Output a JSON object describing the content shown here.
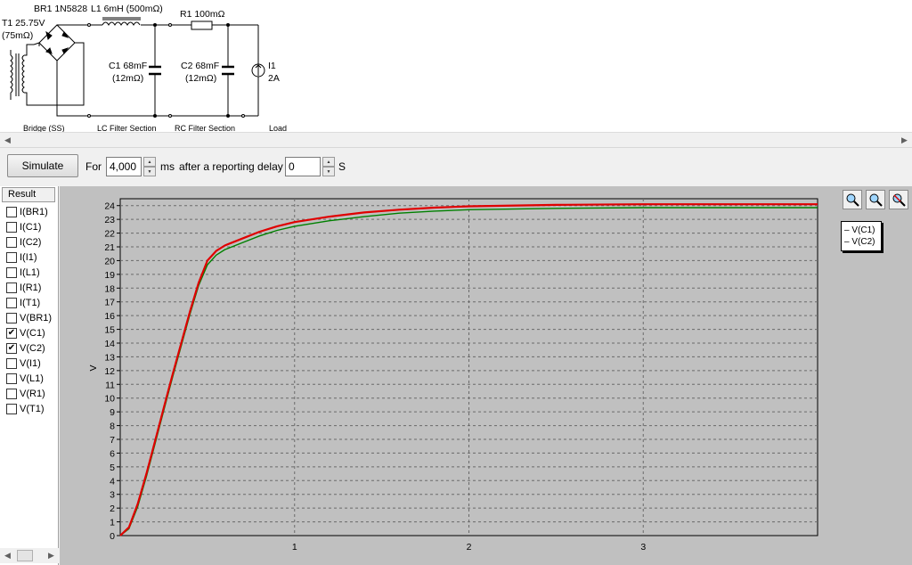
{
  "schematic": {
    "transformer_label": "T1 25.75V",
    "transformer_resistance": "(75mΩ)",
    "bridge_label": "BR1 1N5828",
    "inductor_label": "L1 6mH (500mΩ)",
    "resistor_label": "R1 100mΩ",
    "c1_label": "C1 68mF",
    "c1_resistance": "(12mΩ)",
    "c2_label": "C2 68mF",
    "c2_resistance": "(12mΩ)",
    "load_label": "I1",
    "load_value": "2A",
    "section_bridge": "Bridge (SS)",
    "section_lc": "LC Filter Section",
    "section_rc": "RC Filter Section",
    "section_load": "Load"
  },
  "toolbar": {
    "simulate_label": "Simulate",
    "for_label": "For",
    "duration_value": "4,000",
    "duration_unit": "ms",
    "delay_label": "after a reporting delay of",
    "delay_value": "0",
    "delay_unit": "S"
  },
  "results": {
    "header": "Result",
    "items": [
      {
        "label": "I(BR1)",
        "checked": false
      },
      {
        "label": "I(C1)",
        "checked": false
      },
      {
        "label": "I(C2)",
        "checked": false
      },
      {
        "label": "I(I1)",
        "checked": false
      },
      {
        "label": "I(L1)",
        "checked": false
      },
      {
        "label": "I(R1)",
        "checked": false
      },
      {
        "label": "I(T1)",
        "checked": false
      },
      {
        "label": "V(BR1)",
        "checked": false
      },
      {
        "label": "V(C1)",
        "checked": true
      },
      {
        "label": "V(C2)",
        "checked": true
      },
      {
        "label": "V(I1)",
        "checked": false
      },
      {
        "label": "V(L1)",
        "checked": false
      },
      {
        "label": "V(R1)",
        "checked": false
      },
      {
        "label": "V(T1)",
        "checked": false
      }
    ]
  },
  "legend": {
    "items": [
      "V(C1)",
      "V(C2)"
    ]
  },
  "chart_data": {
    "type": "line",
    "xlabel": "",
    "ylabel": "V",
    "xlim": [
      0,
      4
    ],
    "ylim": [
      0,
      24.5
    ],
    "x_ticks": [
      1,
      2,
      3
    ],
    "y_ticks": [
      0,
      1,
      2,
      3,
      4,
      5,
      6,
      7,
      8,
      9,
      10,
      11,
      12,
      13,
      14,
      15,
      16,
      17,
      18,
      19,
      20,
      21,
      22,
      23,
      24
    ],
    "grid": true,
    "legend_position": "right",
    "series": [
      {
        "name": "V(C1)",
        "color": "#e00000",
        "x": [
          0.0,
          0.05,
          0.1,
          0.15,
          0.2,
          0.25,
          0.3,
          0.35,
          0.4,
          0.45,
          0.5,
          0.55,
          0.6,
          0.7,
          0.8,
          0.9,
          1.0,
          1.2,
          1.4,
          1.6,
          1.8,
          2.0,
          2.5,
          3.0,
          3.5,
          4.0
        ],
        "y": [
          0.0,
          0.6,
          2.3,
          4.5,
          6.9,
          9.3,
          11.7,
          14.0,
          16.3,
          18.4,
          20.0,
          20.7,
          21.1,
          21.6,
          22.1,
          22.5,
          22.8,
          23.2,
          23.5,
          23.7,
          23.85,
          23.95,
          24.05,
          24.1,
          24.1,
          24.1
        ]
      },
      {
        "name": "V(C2)",
        "color": "#008000",
        "x": [
          0.0,
          0.05,
          0.1,
          0.15,
          0.2,
          0.25,
          0.3,
          0.35,
          0.4,
          0.45,
          0.5,
          0.55,
          0.6,
          0.7,
          0.8,
          0.9,
          1.0,
          1.2,
          1.4,
          1.6,
          1.8,
          2.0,
          2.5,
          3.0,
          3.5,
          4.0
        ],
        "y": [
          0.0,
          0.5,
          2.1,
          4.3,
          6.7,
          9.1,
          11.5,
          13.8,
          16.1,
          18.2,
          19.7,
          20.4,
          20.8,
          21.3,
          21.8,
          22.2,
          22.5,
          22.9,
          23.2,
          23.45,
          23.6,
          23.7,
          23.8,
          23.85,
          23.85,
          23.85
        ]
      }
    ]
  }
}
